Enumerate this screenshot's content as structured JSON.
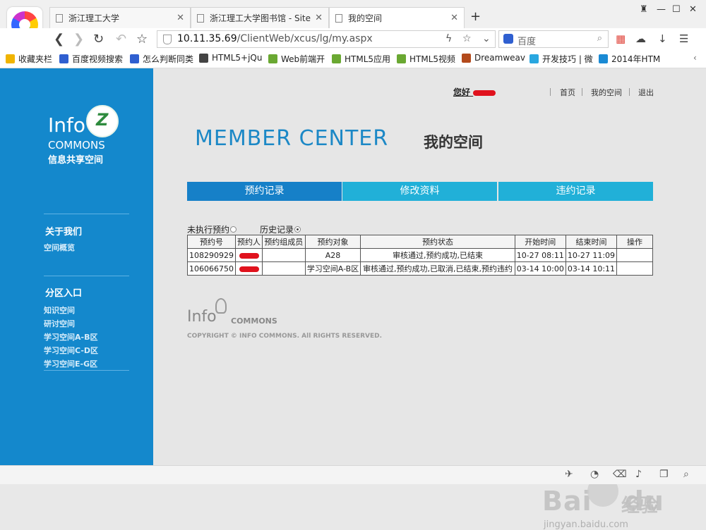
{
  "browser": {
    "tabs": [
      {
        "title": "浙江理工大学"
      },
      {
        "title": "浙江理工大学图书馆 - Site"
      },
      {
        "title": "我的空间"
      }
    ],
    "new_tab": "+",
    "window_controls": {
      "skin": "♜",
      "minimize": "—",
      "maximize": "☐",
      "close": "✕"
    },
    "nav": {
      "back": "❮",
      "forward": "❯",
      "reload": "↻",
      "undo": "↶",
      "star": "☆"
    },
    "url": {
      "host": "10.11.35.69",
      "path": "/ClientWeb/xcus/lg/my.aspx"
    },
    "search_placeholder": "百度",
    "bookmarks": [
      {
        "label": "收藏夹栏",
        "color": "#f0b400"
      },
      {
        "label": "百度视频搜索",
        "color": "#2f5fd0"
      },
      {
        "label": "怎么判断同类",
        "color": "#2f5fd0"
      },
      {
        "label": "HTML5+jQu",
        "color": "#444444"
      },
      {
        "label": "Web前端开",
        "color": "#6aa832"
      },
      {
        "label": "HTML5应用",
        "color": "#6aa832"
      },
      {
        "label": "HTML5视频",
        "color": "#6aa832"
      },
      {
        "label": "Dreamweav",
        "color": "#b34a1c"
      },
      {
        "label": "开发技巧 | 微",
        "color": "#29a7e0"
      },
      {
        "label": "2014年HTM",
        "color": "#1a8ad4"
      }
    ]
  },
  "sidebar": {
    "brand_info": "Info",
    "brand_commons": "COMMONS",
    "brand_cn": "信息共享空间",
    "sections": [
      {
        "heading": "关于我们",
        "links": [
          "空间概览"
        ]
      },
      {
        "heading": "分区入口",
        "links": [
          "知识空间",
          "研讨空间",
          "学习空间A-B区",
          "学习空间C-D区",
          "学习空间E-G区"
        ]
      }
    ]
  },
  "header": {
    "greeting": "您好",
    "nav": [
      "首页",
      "我的空间",
      "退出"
    ],
    "title_en": "MEMBER CENTER",
    "title_cn": "我的空间"
  },
  "tabs": [
    "预约记录",
    "修改资料",
    "违约记录"
  ],
  "filters": [
    {
      "label": "未执行预约",
      "checked": false
    },
    {
      "label": "历史记录",
      "checked": true
    }
  ],
  "table": {
    "columns": [
      "预约号",
      "预约人",
      "预约组成员",
      "预约对象",
      "预约状态",
      "开始时间",
      "结束时间",
      "操作"
    ],
    "rows": [
      [
        "108290929",
        "",
        "",
        "A28",
        "审核通过,预约成功,已结束",
        "10-27 08:11",
        "10-27 11:09",
        ""
      ],
      [
        "106066750",
        "",
        "",
        "学习空间A-B区",
        "审核通过,预约成功,已取消,已结束,预约违约",
        "03-14 10:00",
        "03-14 10:11",
        ""
      ]
    ]
  },
  "footer": {
    "info": "Info",
    "commons": "COMMONS",
    "copyright": "COPYRIGHT © INFO COMMONS. All RIGHTS RESERVED."
  },
  "watermark": {
    "brand": "Bai",
    "brand2": "du",
    "jingyan": "经验",
    "url": "jingyan.baidu.com"
  },
  "colors": {
    "sidebar": "#1488cc",
    "tab_active": "#1680c8",
    "tab": "#21b0d8",
    "title": "#1c88c6"
  }
}
